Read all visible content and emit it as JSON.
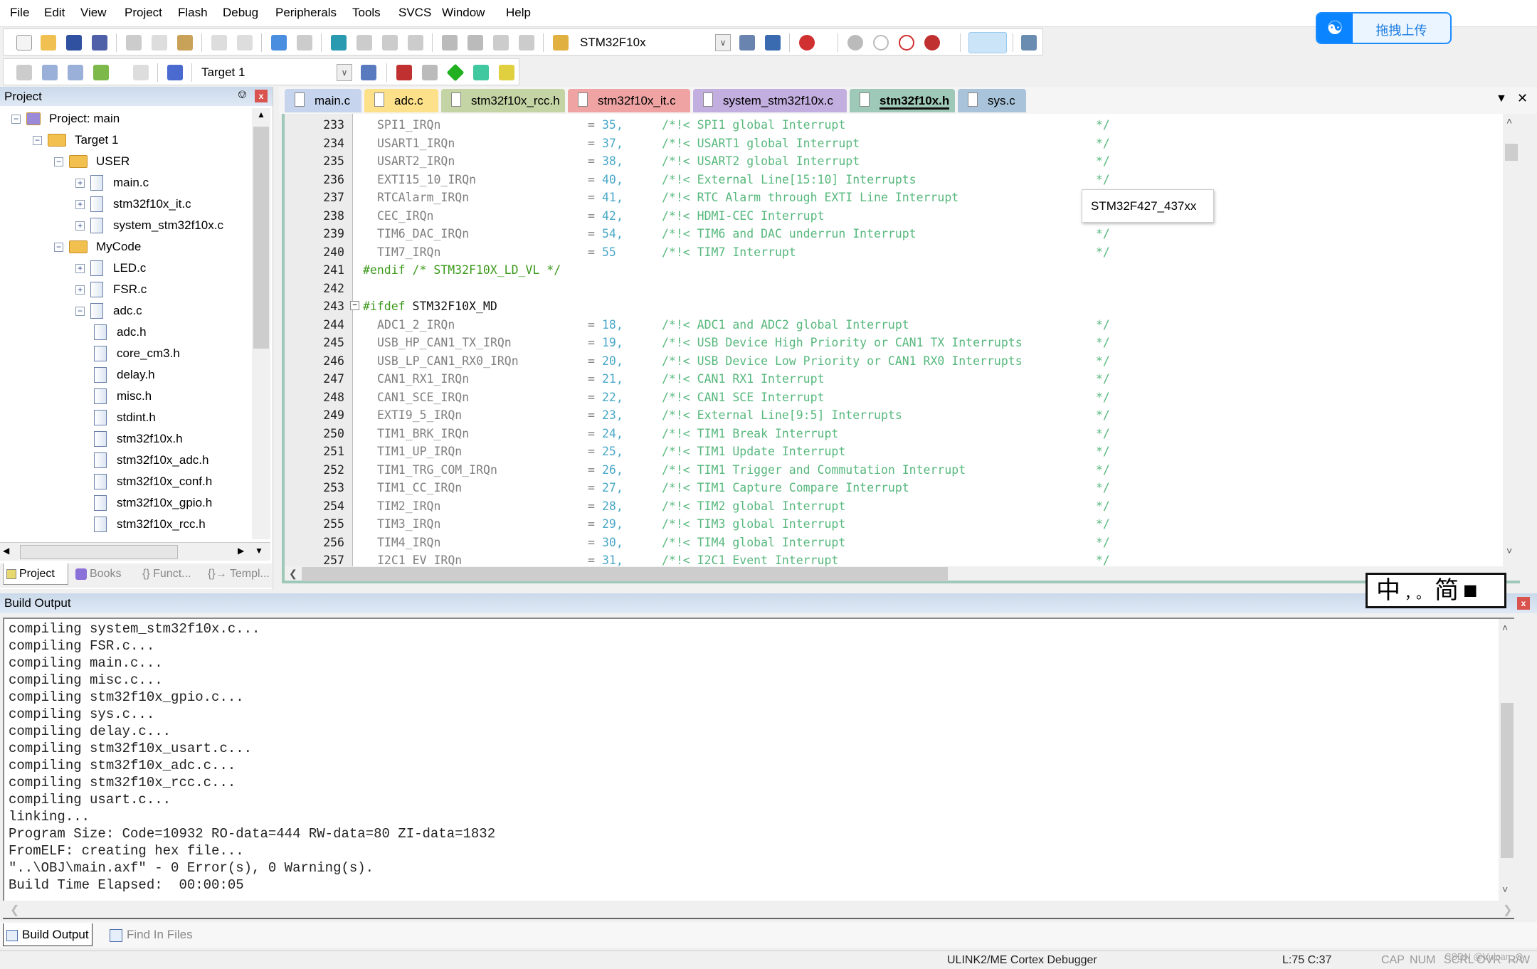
{
  "menu": [
    "File",
    "Edit",
    "View",
    "Project",
    "Flash",
    "Debug",
    "Peripherals",
    "Tools",
    "SVCS",
    "Window",
    "Help"
  ],
  "toolbar1": {
    "device_combo": "STM32F10x"
  },
  "toolbar2": {
    "target_combo": "Target 1"
  },
  "upload_button": {
    "label": "拖拽上传",
    "color": "#0a84ff"
  },
  "project_panel": {
    "title": "Project",
    "tree": [
      {
        "label": "Project: main",
        "level": 0,
        "type": "project",
        "expander": "-"
      },
      {
        "label": "Target 1",
        "level": 1,
        "type": "target",
        "expander": "-"
      },
      {
        "label": "USER",
        "level": 2,
        "type": "folder",
        "expander": "-"
      },
      {
        "label": "main.c",
        "level": 3,
        "type": "file",
        "expander": "+"
      },
      {
        "label": "stm32f10x_it.c",
        "level": 3,
        "type": "file",
        "expander": "+"
      },
      {
        "label": "system_stm32f10x.c",
        "level": 3,
        "type": "file",
        "expander": "+"
      },
      {
        "label": "MyCode",
        "level": 2,
        "type": "folder",
        "expander": "-"
      },
      {
        "label": "LED.c",
        "level": 3,
        "type": "file",
        "expander": "+"
      },
      {
        "label": "FSR.c",
        "level": 3,
        "type": "file",
        "expander": "+"
      },
      {
        "label": "adc.c",
        "level": 3,
        "type": "file",
        "expander": "-"
      },
      {
        "label": "adc.h",
        "level": 4,
        "type": "header",
        "expander": ""
      },
      {
        "label": "core_cm3.h",
        "level": 4,
        "type": "header",
        "expander": ""
      },
      {
        "label": "delay.h",
        "level": 4,
        "type": "header",
        "expander": ""
      },
      {
        "label": "misc.h",
        "level": 4,
        "type": "header",
        "expander": ""
      },
      {
        "label": "stdint.h",
        "level": 4,
        "type": "header",
        "expander": ""
      },
      {
        "label": "stm32f10x.h",
        "level": 4,
        "type": "header",
        "expander": ""
      },
      {
        "label": "stm32f10x_adc.h",
        "level": 4,
        "type": "header",
        "expander": ""
      },
      {
        "label": "stm32f10x_conf.h",
        "level": 4,
        "type": "header",
        "expander": ""
      },
      {
        "label": "stm32f10x_gpio.h",
        "level": 4,
        "type": "header",
        "expander": ""
      },
      {
        "label": "stm32f10x_rcc.h",
        "level": 4,
        "type": "header",
        "expander": ""
      }
    ],
    "tabs": [
      "Project",
      "Books",
      "{} Funct...",
      "{}→ Templ..."
    ]
  },
  "editor": {
    "tabs": [
      {
        "label": "main.c",
        "color": "#c6d4ee"
      },
      {
        "label": "adc.c",
        "color": "#fde08a"
      },
      {
        "label": "stm32f10x_rcc.h",
        "color": "#c5d4a4"
      },
      {
        "label": "stm32f10x_it.c",
        "color": "#efa3a3"
      },
      {
        "label": "system_stm32f10x.c",
        "color": "#c3aee0"
      },
      {
        "label": "stm32f10x.h",
        "color": "#9ec8b8",
        "active": true
      },
      {
        "label": "sys.c",
        "color": "#a9c4da"
      }
    ],
    "lines": [
      {
        "num": "233",
        "ident": "SPI1_IRQn",
        "value": "35,",
        "comment": "/*!< SPI1 global Interrupt",
        "end": "*/"
      },
      {
        "num": "234",
        "ident": "USART1_IRQn",
        "value": "37,",
        "comment": "/*!< USART1 global Interrupt",
        "end": "*/"
      },
      {
        "num": "235",
        "ident": "USART2_IRQn",
        "value": "38,",
        "comment": "/*!< USART2 global Interrupt",
        "end": "*/"
      },
      {
        "num": "236",
        "ident": "EXTI15_10_IRQn",
        "value": "40,",
        "comment": "/*!< External Line[15:10] Interrupts",
        "end": "*/"
      },
      {
        "num": "237",
        "ident": "RTCAlarm_IRQn",
        "value": "41,",
        "comment": "/*!< RTC Alarm through EXTI Line Interrupt",
        "end": "*/"
      },
      {
        "num": "238",
        "ident": "CEC_IRQn",
        "value": "42,",
        "comment": "/*!< HDMI-CEC Interrupt",
        "end": "*/"
      },
      {
        "num": "239",
        "ident": "TIM6_DAC_IRQn",
        "value": "54,",
        "comment": "/*!< TIM6 and DAC underrun Interrupt",
        "end": "*/"
      },
      {
        "num": "240",
        "ident": "TIM7_IRQn",
        "value": "55",
        "comment": "/*!< TIM7 Interrupt",
        "end": "*/"
      },
      {
        "num": "241",
        "pp": "#endif /* STM32F10X_LD_VL */"
      },
      {
        "num": "242"
      },
      {
        "num": "243",
        "pp": "#ifdef",
        "macro": " STM32F10X_MD",
        "fold": true
      },
      {
        "num": "244",
        "ident": "ADC1_2_IRQn",
        "value": "18,",
        "comment": "/*!< ADC1 and ADC2 global Interrupt",
        "end": "*/"
      },
      {
        "num": "245",
        "ident": "USB_HP_CAN1_TX_IRQn",
        "value": "19,",
        "comment": "/*!< USB Device High Priority or CAN1 TX Interrupts",
        "end": "*/"
      },
      {
        "num": "246",
        "ident": "USB_LP_CAN1_RX0_IRQn",
        "value": "20,",
        "comment": "/*!< USB Device Low Priority or CAN1 RX0 Interrupts",
        "end": "*/"
      },
      {
        "num": "247",
        "ident": "CAN1_RX1_IRQn",
        "value": "21,",
        "comment": "/*!< CAN1 RX1 Interrupt",
        "end": "*/"
      },
      {
        "num": "248",
        "ident": "CAN1_SCE_IRQn",
        "value": "22,",
        "comment": "/*!< CAN1 SCE Interrupt",
        "end": "*/"
      },
      {
        "num": "249",
        "ident": "EXTI9_5_IRQn",
        "value": "23,",
        "comment": "/*!< External Line[9:5] Interrupts",
        "end": "*/"
      },
      {
        "num": "250",
        "ident": "TIM1_BRK_IRQn",
        "value": "24,",
        "comment": "/*!< TIM1 Break Interrupt",
        "end": "*/"
      },
      {
        "num": "251",
        "ident": "TIM1_UP_IRQn",
        "value": "25,",
        "comment": "/*!< TIM1 Update Interrupt",
        "end": "*/"
      },
      {
        "num": "252",
        "ident": "TIM1_TRG_COM_IRQn",
        "value": "26,",
        "comment": "/*!< TIM1 Trigger and Commutation Interrupt",
        "end": "*/"
      },
      {
        "num": "253",
        "ident": "TIM1_CC_IRQn",
        "value": "27,",
        "comment": "/*!< TIM1 Capture Compare Interrupt",
        "end": "*/"
      },
      {
        "num": "254",
        "ident": "TIM2_IRQn",
        "value": "28,",
        "comment": "/*!< TIM2 global Interrupt",
        "end": "*/"
      },
      {
        "num": "255",
        "ident": "TIM3_IRQn",
        "value": "29,",
        "comment": "/*!< TIM3 global Interrupt",
        "end": "*/"
      },
      {
        "num": "256",
        "ident": "TIM4_IRQn",
        "value": "30,",
        "comment": "/*!< TIM4 global Interrupt",
        "end": "*/"
      },
      {
        "num": "257",
        "ident": "I2C1_EV_IRQn",
        "value": "31,",
        "comment": "/*!< I2C1 Event Interrupt",
        "end": "*/"
      }
    ],
    "tooltip": "STM32F427_437xx"
  },
  "build_output": {
    "title": "Build Output",
    "lines": [
      "compiling system_stm32f10x.c...",
      "compiling FSR.c...",
      "compiling main.c...",
      "compiling misc.c...",
      "compiling stm32f10x_gpio.c...",
      "compiling sys.c...",
      "compiling delay.c...",
      "compiling stm32f10x_usart.c...",
      "compiling stm32f10x_adc.c...",
      "compiling stm32f10x_rcc.c...",
      "compiling usart.c...",
      "linking...",
      "Program Size: Code=10932 RO-data=444 RW-data=80 ZI-data=1832",
      "FromELF: creating hex file...",
      "\"..\\OBJ\\main.axf\" - 0 Error(s), 0 Warning(s).",
      "Build Time Elapsed:  00:00:05"
    ],
    "tabs": [
      "Build Output",
      "Find In Files"
    ]
  },
  "ime": {
    "mode": "中",
    "punct": "，。",
    "script": "简"
  },
  "status": {
    "debugger": "ULINK2/ME Cortex Debugger",
    "position": "L:75 C:37",
    "cap": "CAP",
    "num": "NUM",
    "scrl": "SCRL",
    "ovr": "OVR",
    "rw": "R/W",
    "watermark": "CSDN @Vulcan_Q"
  }
}
